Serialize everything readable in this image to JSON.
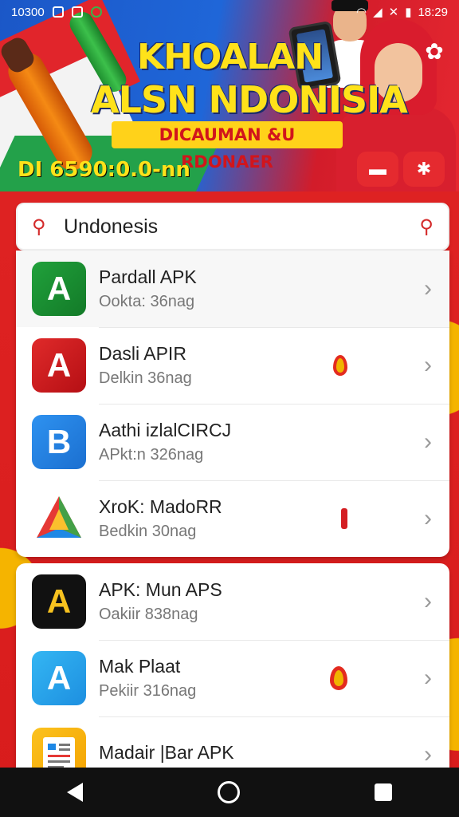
{
  "status_bar": {
    "left_text": "10300",
    "time": "18:29",
    "icons": [
      "notification-icon",
      "nfc-icon",
      "chrome-icon",
      "wifi-icon",
      "signal-icon",
      "mute-icon",
      "battery-icon"
    ]
  },
  "banner": {
    "title_line1": "KHOALAN",
    "title_line2": "ALSN NDONISIA",
    "subtitle": "DICAUMAN &U RDONAER",
    "price": "DI 6590:0.0-nn",
    "buttons": [
      "chat-icon",
      "star-icon"
    ],
    "settings_icon": "gear-icon"
  },
  "search": {
    "query": "Undonesis",
    "left_icon": "search-icon",
    "right_icon": "search-icon"
  },
  "apps": [
    {
      "name": "Pardall APK",
      "sub": "Ookta: 36nag",
      "icon_color": "#1f9a37",
      "icon_glyph": "A"
    },
    {
      "name": "Dasli APIR",
      "sub": "Delkin 36nag",
      "icon_color": "#d41e22",
      "icon_glyph": "A"
    },
    {
      "name": "Aathi izlalCIRCJ",
      "sub": "APkt:n 326nag",
      "icon_color": "#2a8ae8",
      "icon_glyph": "B"
    },
    {
      "name": "XroK: MadoRR",
      "sub": "Bedkin 30nag",
      "icon_color": "#e53935",
      "icon_glyph": ""
    },
    {
      "name": "APK: Mun APS",
      "sub": "Oakiir 838nag",
      "icon_color": "#111111",
      "icon_glyph": "A"
    },
    {
      "name": "Mak Plaat",
      "sub": "Pekiir 316nag",
      "icon_color": "#2ea8ef",
      "icon_glyph": "A"
    },
    {
      "name": "Madair |Bar APK",
      "sub": "",
      "icon_color": "#f7b81a",
      "icon_glyph": ""
    }
  ],
  "nav": {
    "back": "back-icon",
    "home": "home-icon",
    "recents": "recents-icon"
  }
}
